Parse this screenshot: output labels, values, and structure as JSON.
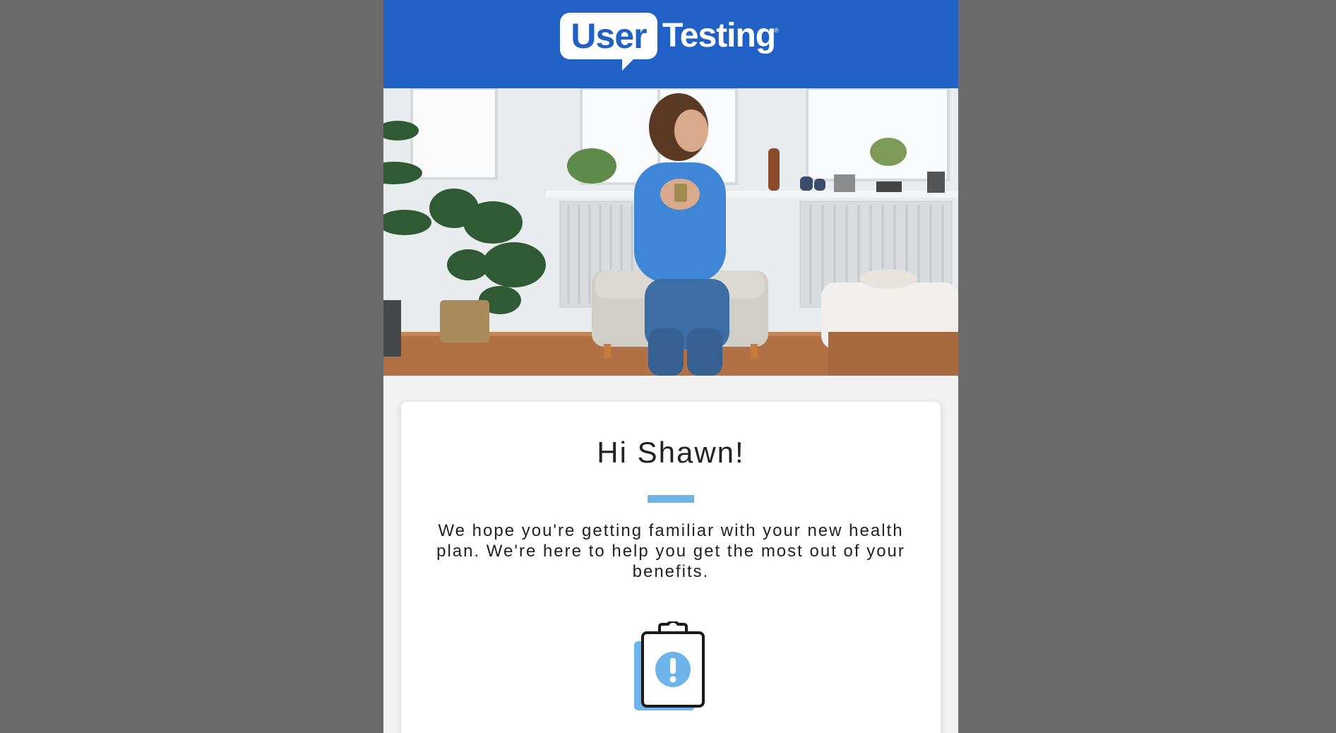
{
  "header": {
    "logo_user": "User",
    "logo_testing": "Testing",
    "logo_reg": "®",
    "background_color": "#2160c4"
  },
  "hero": {
    "description": "hero-photo"
  },
  "card": {
    "greeting": "Hi Shawn!",
    "message": "We hope you're getting familiar with your new health plan. We're here to help you get the most out of your benefits.",
    "accent_color": "#6cb4ea",
    "icon": "clipboard-alert-icon"
  }
}
